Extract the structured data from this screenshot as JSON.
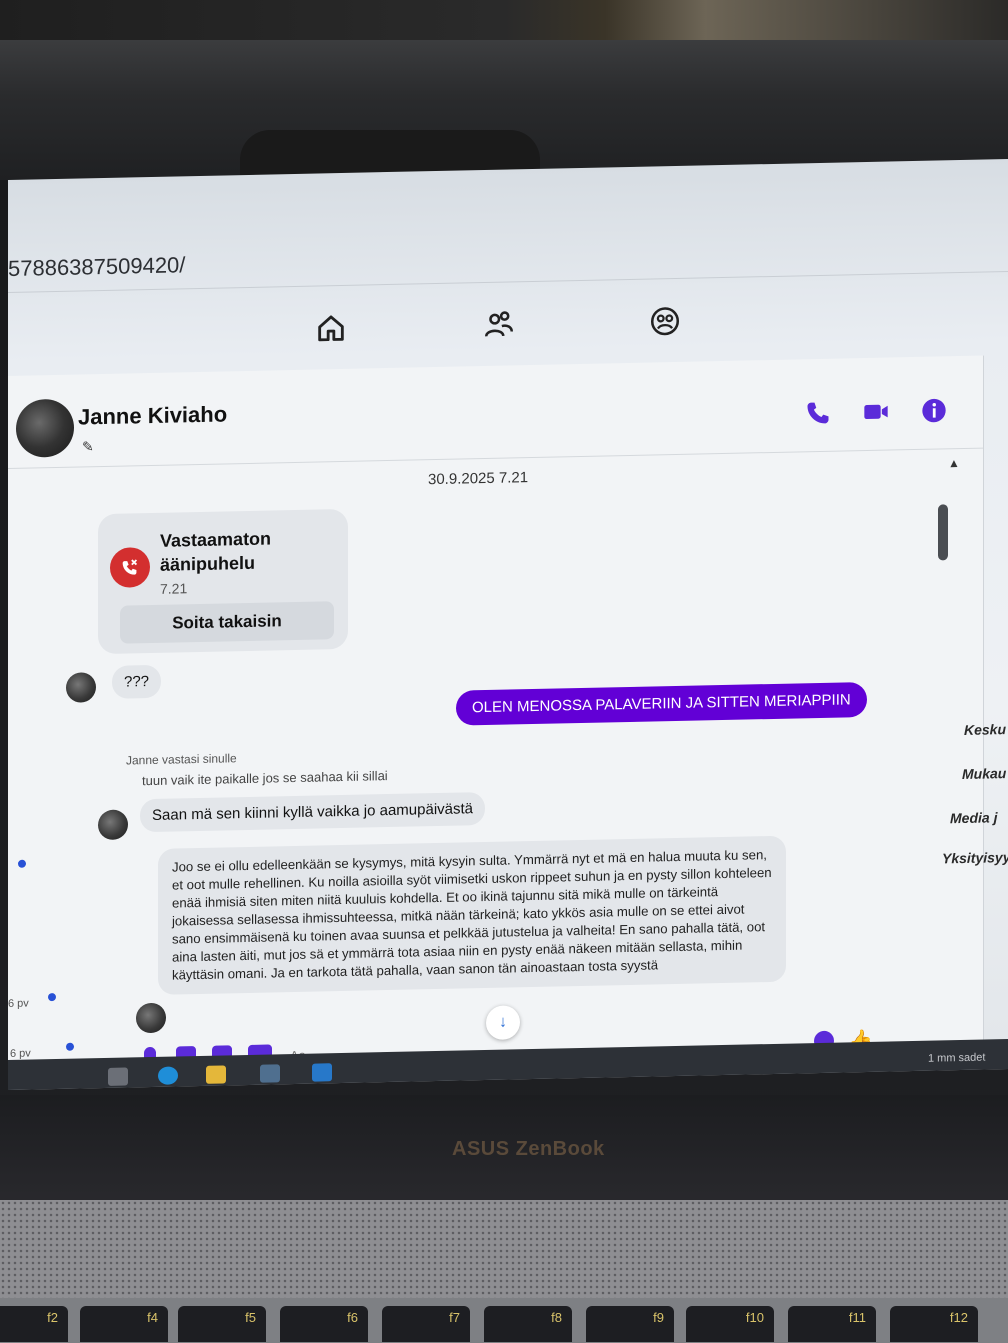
{
  "browser": {
    "url_fragment": "578863875094​20/"
  },
  "topnav": {
    "icons": [
      "home-icon",
      "people-icon",
      "profile-icon"
    ]
  },
  "chat": {
    "contact_name": "Janne Kiviaho",
    "date_stamp": "30.9.2025 7.21",
    "missed_call": {
      "title": "Vastaamaton äänipuhelu",
      "time": "7.21",
      "callback_label": "Soita takaisin"
    },
    "messages": [
      {
        "direction": "in",
        "text": "???"
      },
      {
        "direction": "out",
        "text": "OLEN MENOSSA PALAVERIIN JA SITTEN MERIAPPIIN"
      },
      {
        "direction": "in",
        "reply_label": "Janne vastasi sinulle",
        "quoted": "tuun vaik ite paikalle jos se saahaa kii sillai",
        "text": "Saan mä sen kiinni kyllä vaikka jo aamupäivästä"
      },
      {
        "direction": "in",
        "text": "Joo se ei ollu edelleenkään se kysymys, mitä kysyin sulta. Ymmärrä nyt et mä en halua muuta ku sen, et oot mulle rehellinen. Ku noilla asioilla syöt viimisetki uskon rippeet suhun ja en pysty sillon kohteleen enää ihmisiä siten miten niitä kuuluis kohdella. Et oo ikinä tajunnu sitä mikä mulle on tärkeintä jokaisessa sellasessa ihmissuhteessa, mitkä nään tärkeinä; kato ykkös asia mulle on se ettei aivot sano ensimmäisenä ku toinen avaa suunsa et pelkkää jutustelua ja valheita! En sano pahalla tätä, oot aina lasten äiti, mut jos sä et ymmärrä tota asiaa niin en pysty enää näkeen mitään sellasta, mihin käyttäsin omani. Ja en tarkota tätä pahalla, vaan sanon tän ainoastaan tosta syystä"
      }
    ],
    "composer_placeholder": "Aa"
  },
  "right_sidebar": {
    "items": [
      "Kesku",
      "Mukau",
      "Media j",
      "Yksityisyy"
    ]
  },
  "left_edge": {
    "items": [
      "6 pv",
      "6 pv"
    ]
  },
  "taskbar": {
    "tray_text": "1 mm sadet"
  },
  "device": {
    "brand": "ASUS ZenBook",
    "function_keys": [
      "f2",
      "f4",
      "f5",
      "f6",
      "f7",
      "f8",
      "f9",
      "f10",
      "f11",
      "f12"
    ]
  },
  "colors": {
    "accent": "#6200d6",
    "icon_purple": "#5b2bd9",
    "missed_call_red": "#d32f2f"
  }
}
